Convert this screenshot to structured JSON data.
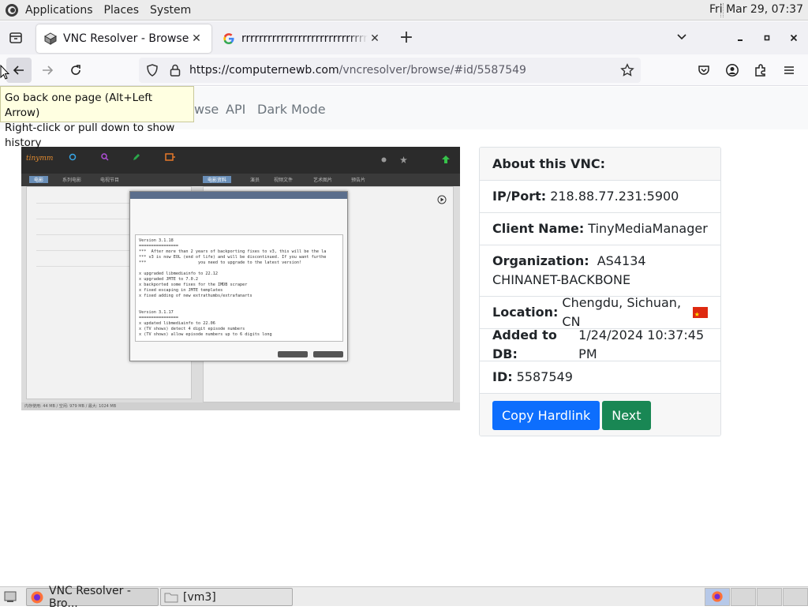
{
  "topbar": {
    "menus": [
      "Applications",
      "Places",
      "System"
    ],
    "clock": "Fri Mar 29, 07:37"
  },
  "browser": {
    "tabs": [
      {
        "title": "VNC Resolver - Browse",
        "active": true
      },
      {
        "title": "rrrrrrrrrrrrrrrrrrrrrrrrrrrrrrrr",
        "active": false
      }
    ],
    "url_host": "https://computernewb.com",
    "url_path": "/vncresolver/browse/#id/5587549",
    "tooltip_line1": "Go back one page (Alt+Left Arrow)",
    "tooltip_line2": "Right-click or pull down to show history"
  },
  "pagenav": {
    "links": [
      "Browse",
      "API",
      "Dark Mode"
    ],
    "browse_visible": "wse"
  },
  "screenshot": {
    "brand": "tinymm",
    "dialog_text": "Version 3.1.18\n================\n***  After more than 2 years of backporting fixes to v3, this will be the la\n*** v3 is now EOL (end of life) and will be discontinued. If you want furthe\n***                     you need to upgrade to the latest version!\n\nx upgraded libmediainfo to 22.12\nx upgraded JMTE to 7.0.2\nx backported some fixes for the IMDB scraper\nx fixed escaping in JMTE templates\nx fixed adding of new extrathumbs/extrafanarts\n\n\nVersion 3.1.17\n================\nx updated libmediainfo to 22.06\nx (TV shows) detect 4 digit episode numbers\nx (TV shows) allow episode numbers up to 6 digits long",
    "status": "内存使用: 44 MB / 空闲: 979 MB / 最大: 1024 MB"
  },
  "card": {
    "header": "About this VNC:",
    "rows": [
      {
        "label": "IP/Port:",
        "value": "218.88.77.231:5900"
      },
      {
        "label": "Client Name:",
        "value": "TinyMediaManager"
      },
      {
        "label": "Organization:",
        "value": "AS4134 CHINANET-BACKBONE"
      },
      {
        "label": "Location:",
        "value": "Chengdu, Sichuan, CN"
      },
      {
        "label": "Added to DB:",
        "value": "1/24/2024 10:37:45 PM"
      },
      {
        "label": "ID:",
        "value": "5587549"
      }
    ],
    "buttons": {
      "copy": "Copy Hardlink",
      "next": "Next"
    }
  },
  "taskbar": {
    "items": [
      "VNC Resolver - Bro...",
      "[vm3]"
    ]
  },
  "colors": {
    "primary": "#0d6efd",
    "success": "#198754",
    "flag_red": "#de2910"
  }
}
